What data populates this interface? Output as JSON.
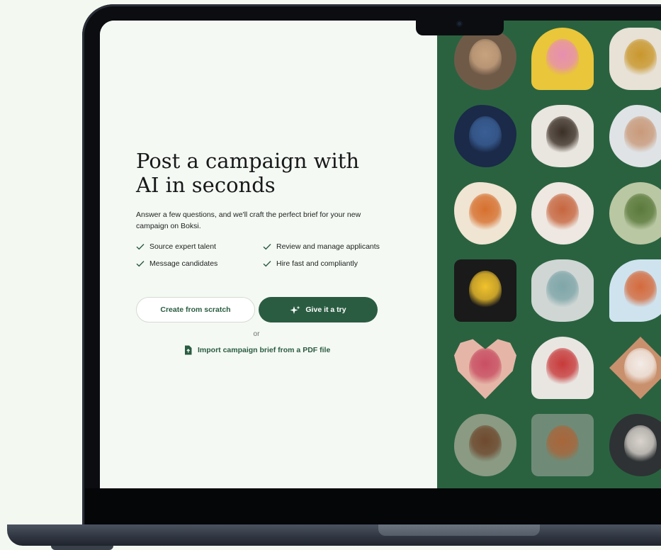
{
  "hero": {
    "headline": "Post a campaign with\nAI in seconds",
    "intro": "Answer a few questions, and we'll craft the perfect brief for your new campaign on Boksi."
  },
  "features": [
    "Source expert talent",
    "Review and manage applicants",
    "Message candidates",
    "Hire fast and compliantly"
  ],
  "actions": {
    "create_label": "Create from scratch",
    "try_label": "Give it a try",
    "or_label": "or",
    "import_label": "Import campaign brief from a PDF file"
  },
  "icons": {
    "check": "check-icon",
    "sparkle": "sparkle-icon",
    "document": "document-upload-icon"
  },
  "colors": {
    "brand_green": "#2a5c41",
    "gallery_bg": "#2a6240",
    "page_bg": "#f5f9f3"
  },
  "gallery": [
    {
      "subject": "woman holding glass",
      "bg": "#6f5a48",
      "accent": "#c9a37f"
    },
    {
      "subject": "woman in pink with sunglasses",
      "bg": "#e9c63a",
      "accent": "#e78fb0"
    },
    {
      "subject": "gold chocolate bunnies",
      "bg": "#e7e1d6",
      "accent": "#c9972c"
    },
    {
      "subject": "luxury watch",
      "bg": "#1a2a48",
      "accent": "#3a5f96"
    },
    {
      "subject": "man with beard trimmer",
      "bg": "#e9e5df",
      "accent": "#3b2f26"
    },
    {
      "subject": "baby eating",
      "bg": "#dfe3e6",
      "accent": "#c99a7a"
    },
    {
      "subject": "snack basket",
      "bg": "#f0e4d2",
      "accent": "#d6702e"
    },
    {
      "subject": "redhead woman with product",
      "bg": "#efe7e1",
      "accent": "#c6663f"
    },
    {
      "subject": "matcha pouch",
      "bg": "#b9c7a2",
      "accent": "#5b7a3c"
    },
    {
      "subject": "woman in yellow with drink",
      "bg": "#1a1a1a",
      "accent": "#f1c22d"
    },
    {
      "subject": "hands with book and box",
      "bg": "#cfd6d4",
      "accent": "#7fa6a9"
    },
    {
      "subject": "woman with snacks",
      "bg": "#cfe3ef",
      "accent": "#d46a3c"
    },
    {
      "subject": "woman eating",
      "bg": "#e5b6a7",
      "accent": "#c94f63"
    },
    {
      "subject": "hard seltzer cans",
      "bg": "#e9e6e2",
      "accent": "#c73a3a"
    },
    {
      "subject": "woman skincare",
      "bg": "#c9906d",
      "accent": "#f3ece7"
    },
    {
      "subject": "dog with toy",
      "bg": "#8a9a83",
      "accent": "#6f4a2f"
    },
    {
      "subject": "dog in forest",
      "bg": "#6f8b77",
      "accent": "#a8663b"
    },
    {
      "subject": "barista with coffee",
      "bg": "#2e3234",
      "accent": "#d9d4cd"
    }
  ]
}
